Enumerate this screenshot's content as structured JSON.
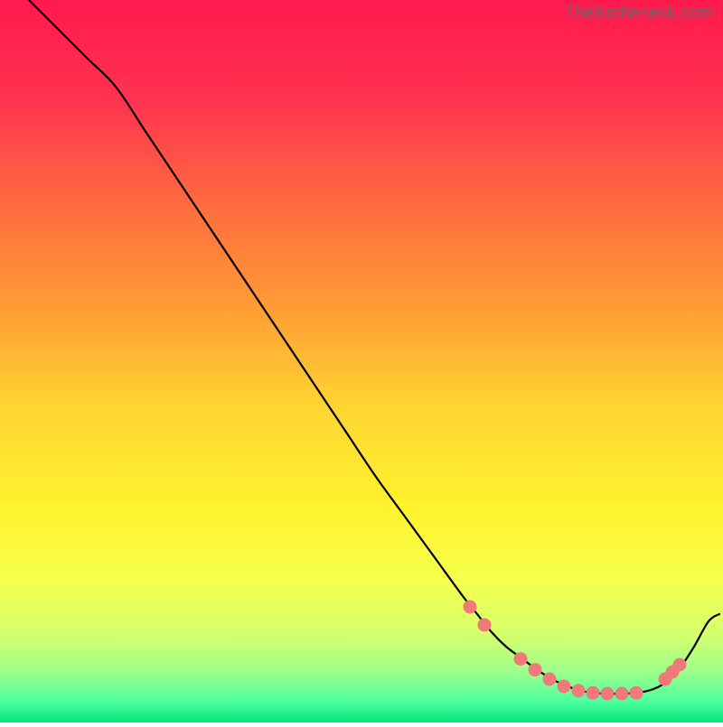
{
  "watermark": "TheBottleneck.com",
  "chart_data": {
    "type": "line",
    "title": "",
    "xlabel": "",
    "ylabel": "",
    "xlim": [
      0,
      100
    ],
    "ylim": [
      0,
      100
    ],
    "series": [
      {
        "name": "curve",
        "stroke": "#000000",
        "stroke_width": 2.2,
        "x": [
          4,
          8,
          12,
          16,
          20,
          24,
          28,
          32,
          36,
          40,
          44,
          48,
          52,
          56,
          60,
          64,
          66,
          68,
          70,
          72,
          74,
          76,
          78,
          80,
          82,
          84,
          86,
          88,
          90,
          92,
          94,
          96,
          98,
          99.5
        ],
        "y": [
          100,
          96,
          92,
          88,
          82,
          76,
          70,
          64,
          58,
          52,
          46,
          40,
          34,
          28.5,
          23,
          17.5,
          15,
          12.5,
          10.5,
          9,
          7.5,
          6.2,
          5.2,
          4.5,
          4.1,
          4.0,
          4.0,
          4.1,
          4.5,
          5.5,
          7.5,
          10.5,
          14,
          15
        ]
      },
      {
        "name": "markers",
        "type": "scatter",
        "stroke": "none",
        "fill": "#ef7a7a",
        "radius": 7.5,
        "x": [
          65,
          67,
          72,
          74,
          76,
          78,
          80,
          82,
          84,
          86,
          88,
          92,
          93,
          94
        ],
        "y": [
          16,
          13.5,
          8.8,
          7.3,
          6.0,
          5.0,
          4.4,
          4.1,
          4.0,
          4.0,
          4.1,
          6.0,
          7.0,
          8.0
        ]
      }
    ],
    "background_gradient": {
      "type": "vertical",
      "stops": [
        {
          "offset": 0.0,
          "color": "#ff1a4d"
        },
        {
          "offset": 0.14,
          "color": "#ff3350"
        },
        {
          "offset": 0.28,
          "color": "#ff6a3f"
        },
        {
          "offset": 0.42,
          "color": "#ff9a35"
        },
        {
          "offset": 0.56,
          "color": "#ffd432"
        },
        {
          "offset": 0.7,
          "color": "#fff22e"
        },
        {
          "offset": 0.8,
          "color": "#f6ff4a"
        },
        {
          "offset": 0.88,
          "color": "#d4ff6e"
        },
        {
          "offset": 0.93,
          "color": "#9dff8a"
        },
        {
          "offset": 0.97,
          "color": "#4fff9f"
        },
        {
          "offset": 1.0,
          "color": "#00e57a"
        }
      ]
    }
  }
}
